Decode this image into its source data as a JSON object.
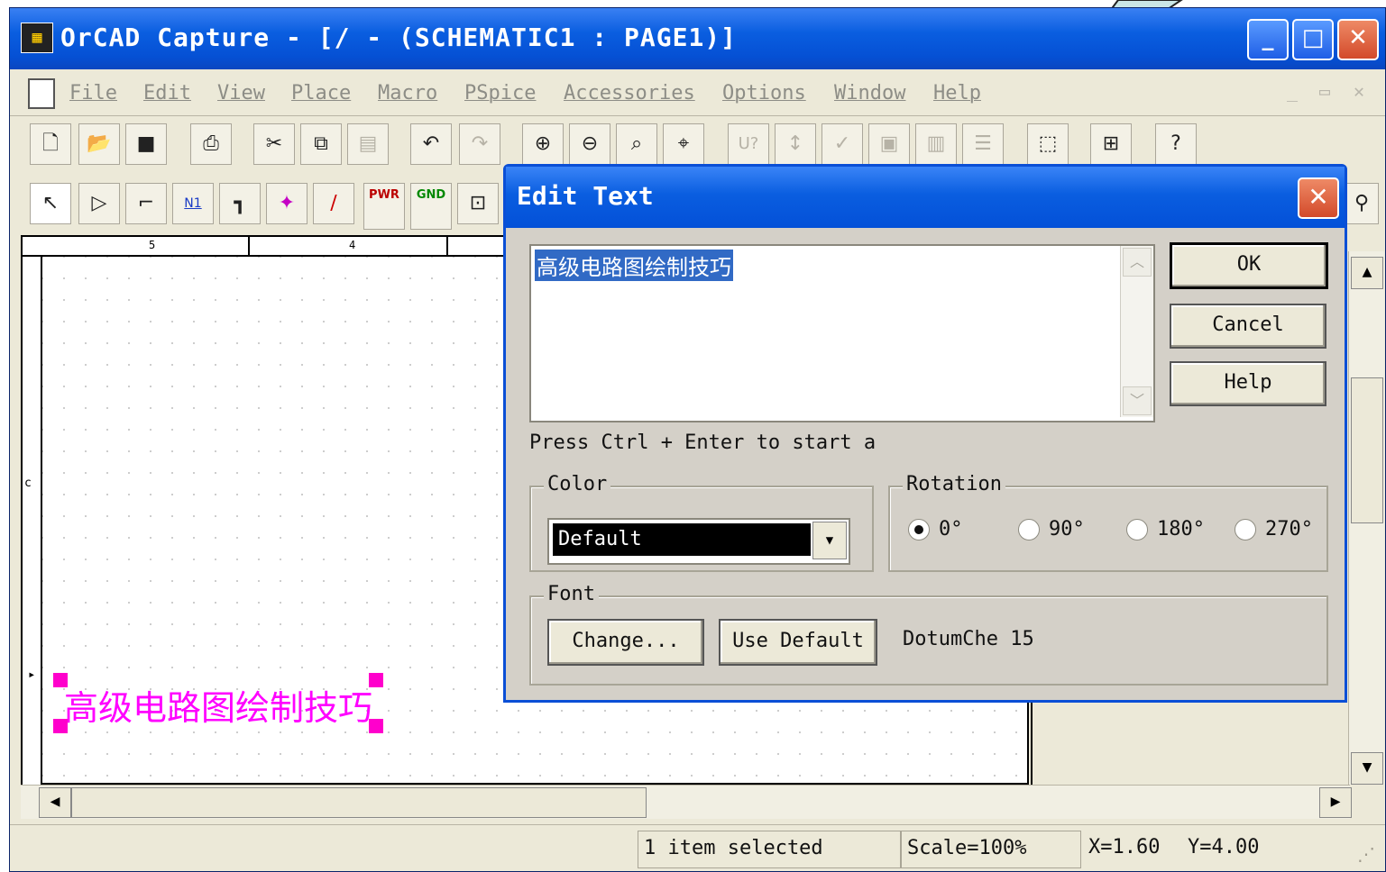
{
  "window": {
    "title": "OrCAD Capture - [/ - (SCHEMATIC1 : PAGE1)]",
    "min_label": "_",
    "max_label": "□",
    "close_label": "✕"
  },
  "menu": [
    "File",
    "Edit",
    "View",
    "Place",
    "Macro",
    "PSpice",
    "Accessories",
    "Options",
    "Window",
    "Help"
  ],
  "mdi_controls": [
    "_",
    "▭",
    "✕"
  ],
  "toolbar_labels": {
    "part_ref": "U?",
    "net_alias": "N1",
    "power": "PWR",
    "ground": "GND"
  },
  "ruler": [
    "5",
    "4"
  ],
  "border_letter": "c",
  "placed_text": "高级电路图绘制技巧",
  "status": {
    "selection": "1 item selected",
    "scale": "Scale=100%",
    "x": "X=1.60",
    "y": "Y=4.00"
  },
  "dialog": {
    "title": "Edit Text",
    "close_label": "✕",
    "text_value": "高级电路图绘制技巧",
    "ok": "OK",
    "cancel": "Cancel",
    "help": "Help",
    "hint": "Press Ctrl + Enter to start a",
    "color_label": "Color",
    "color_value": "Default",
    "rotation_label": "Rotation",
    "rotations": [
      "0°",
      "90°",
      "180°",
      "270°"
    ],
    "selected_rotation": "0°",
    "font_label": "Font",
    "change_button": "Change...",
    "use_default_button": "Use Default",
    "font_name": "DotumChe 15"
  },
  "colors": {
    "titlebar": "#0a5ee0",
    "selection": "#316ac5",
    "placed_text": "#ff00ff"
  }
}
